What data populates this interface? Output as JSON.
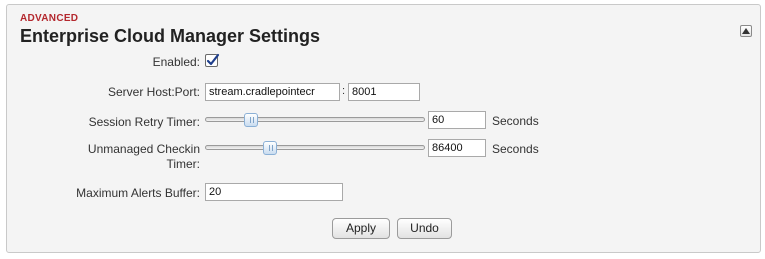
{
  "section": "ADVANCED",
  "title": "Enterprise Cloud Manager Settings",
  "collapse_icon": "triangle-up-icon",
  "fields": {
    "enabled": {
      "label": "Enabled:",
      "checked": true
    },
    "server": {
      "label": "Server Host:Port:",
      "host_value": "stream.cradlepointecr",
      "separator": ":",
      "port_value": "8001"
    },
    "session_retry": {
      "label": "Session Retry Timer:",
      "value": "60",
      "unit": "Seconds",
      "slider_level": 0.19
    },
    "unmanaged_checkin": {
      "label_line1": "Unmanaged Checkin",
      "label_line2": "Timer:",
      "value": "86400",
      "unit": "Seconds",
      "slider_level": 0.28
    },
    "max_alerts": {
      "label": "Maximum Alerts Buffer:",
      "value": "20"
    }
  },
  "buttons": {
    "apply": "Apply",
    "undo": "Undo"
  }
}
